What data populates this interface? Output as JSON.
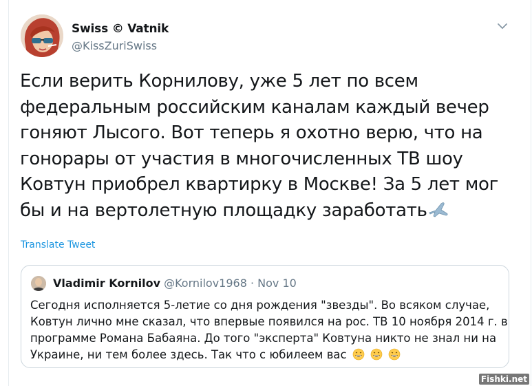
{
  "tweet": {
    "display_name": "Swiss © Vatnik",
    "handle": "@KissZuriSwiss",
    "text_lines": [
      "Если верить Корнилову, уже 5 лет по всем",
      "федеральным российским каналам каждый вечер",
      "гоняют Лысого. Вот теперь я охотно верю, что на",
      "гонорары от участия в многочисленных ТВ шоу",
      "Ковтун приобрел квартирку в Москве! За 5 лет мог",
      "бы и на вертолетную площадку заработать"
    ],
    "translate_label": "Translate Tweet",
    "menu_icon": "chevron-down-icon"
  },
  "quoted_tweet": {
    "display_name": "Vladimir Kornilov",
    "meta": "@Kornilov1968 · Nov 10",
    "text_lines": [
      "Сегодня исполняется 5-летие со дня рождения \"звезды\". Во всяком случае,",
      "Ковтун лично мне сказал, что впервые появился на рос. ТВ 10 ноября 2014 г. в",
      "программе Романа Бабаяна. До того \"эксперта\" Ковтуна никто не знал ни на",
      "Украине, ни тем более здесь. Так что с юбилеем вас"
    ]
  },
  "watermark": "Fishki.net",
  "colors": {
    "link": "#1b95e0",
    "muted": "#657786",
    "border": "#ccd6dd"
  }
}
